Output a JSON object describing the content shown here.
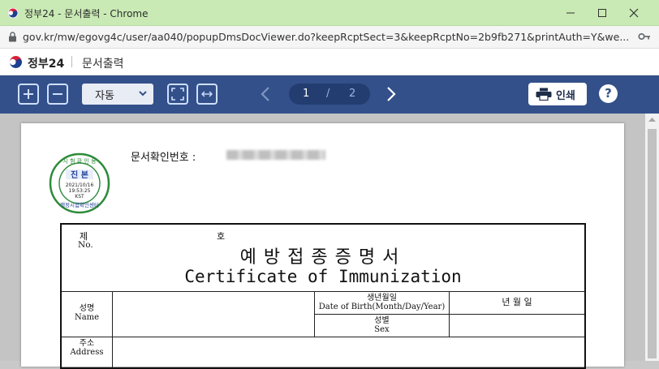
{
  "window": {
    "title": "정부24 - 문서출력 - Chrome"
  },
  "address_bar": {
    "url": "gov.kr/mw/egovg4c/user/aa040/popupDmsDocViewer.do?keepRcptSect=3&keepRcptNo=2b9fb271&printAuth=Y&we..."
  },
  "site_header": {
    "brand": "정부24",
    "page_name": "문서출력"
  },
  "toolbar": {
    "zoom_value": "자동",
    "current_page": "1",
    "page_separator": "/",
    "total_pages": "2",
    "print_label": "인쇄",
    "help_label": "?"
  },
  "document": {
    "doc_number_label": "문서확인번호 :",
    "seal": {
      "top_text": "시 험 확 인 용",
      "main_text": "진 본",
      "date": "2021/10/16",
      "time": "19:53:25",
      "zone": "KST",
      "bottom_text": "행정시험확인센터"
    },
    "certificate": {
      "number_ko": "제",
      "number_en": "No.",
      "number_suffix": "호",
      "title_ko": "예방접종증명서",
      "title_en": "Certificate of Immunization",
      "name_ko": "성명",
      "name_en": "Name",
      "birth_ko": "생년월일",
      "birth_en": "Date of Birth(Month/Day/Year)",
      "birth_value": "년   월   일",
      "sex_ko": "성별",
      "sex_en": "Sex",
      "address_ko": "주소",
      "address_en": "Address"
    }
  },
  "colors": {
    "titlebar": "#c9eab4",
    "toolbar": "#33508a",
    "seal_green": "#2e8b3a",
    "seal_blue": "#1f3f9a"
  }
}
